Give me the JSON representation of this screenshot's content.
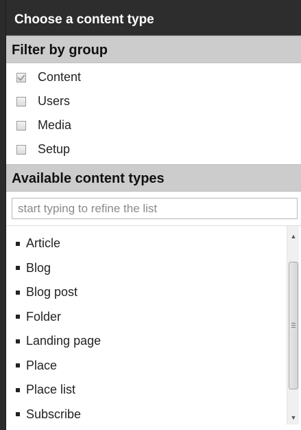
{
  "dialog": {
    "title": "Choose a content type"
  },
  "filter": {
    "heading": "Filter by group",
    "groups": [
      {
        "label": "Content",
        "checked": true
      },
      {
        "label": "Users",
        "checked": false
      },
      {
        "label": "Media",
        "checked": false
      },
      {
        "label": "Setup",
        "checked": false
      }
    ]
  },
  "available": {
    "heading": "Available content types",
    "search_placeholder": "start typing to refine the list",
    "items": [
      "Article",
      "Blog",
      "Blog post",
      "Folder",
      "Landing page",
      "Place",
      "Place list",
      "Subscribe"
    ]
  },
  "icons": {
    "scroll_up": "arrow-up-icon",
    "scroll_down": "arrow-down-icon",
    "bullet": "square-bullet-icon"
  }
}
